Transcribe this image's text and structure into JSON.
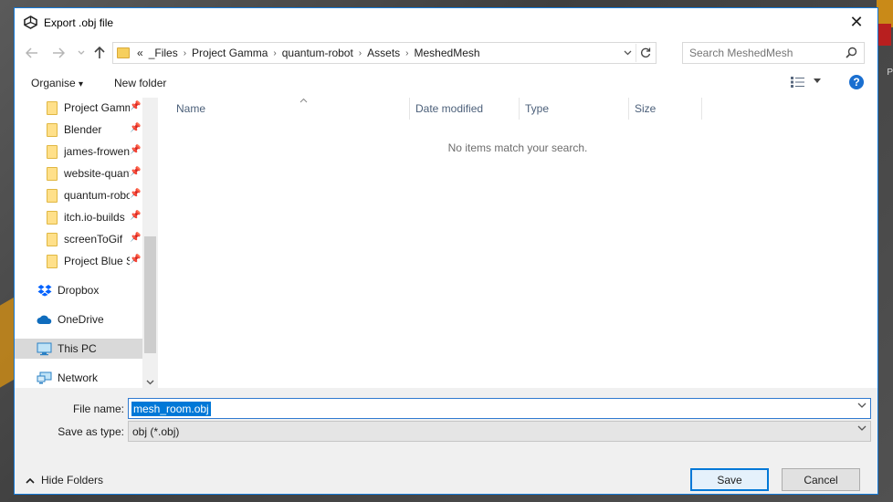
{
  "window": {
    "title": "Export .obj file",
    "close_glyph": "✕"
  },
  "background": {
    "edge_label": "P"
  },
  "address": {
    "overflow": "«",
    "breadcrumbs": [
      "_Files",
      "Project Gamma",
      "quantum-robot",
      "Assets",
      "MeshedMesh"
    ]
  },
  "search": {
    "placeholder": "Search MeshedMesh"
  },
  "commands": {
    "organise": "Organise",
    "organise_caret": "▾",
    "new_folder": "New folder",
    "help": "?"
  },
  "nav": {
    "quick_access": [
      {
        "label": "Project Gamma"
      },
      {
        "label": "Blender"
      },
      {
        "label": "james-frowen"
      },
      {
        "label": "website-quantum"
      },
      {
        "label": "quantum-robot"
      },
      {
        "label": "itch.io-builds"
      },
      {
        "label": "screenToGif"
      },
      {
        "label": "Project Blue Sky"
      }
    ],
    "roots": [
      {
        "label": "Dropbox",
        "icon": "dropbox-icon"
      },
      {
        "label": "OneDrive",
        "icon": "onedrive-icon"
      },
      {
        "label": "This PC",
        "icon": "this-pc-icon",
        "selected": true
      },
      {
        "label": "Network",
        "icon": "network-icon"
      }
    ]
  },
  "list": {
    "columns": [
      "Name",
      "Date modified",
      "Type",
      "Size"
    ],
    "empty_message": "No items match your search."
  },
  "form": {
    "file_name_label": "File name:",
    "file_name_value": "mesh_room.obj",
    "save_as_type_label": "Save as type:",
    "save_as_type_value": "obj (*.obj)"
  },
  "footer": {
    "hide_folders": "Hide Folders",
    "save": "Save",
    "cancel": "Cancel"
  },
  "colors": {
    "accent": "#0078d7",
    "folder": "#ffe08a",
    "selected": "#d9d9d9",
    "header_text": "#4c607a"
  }
}
